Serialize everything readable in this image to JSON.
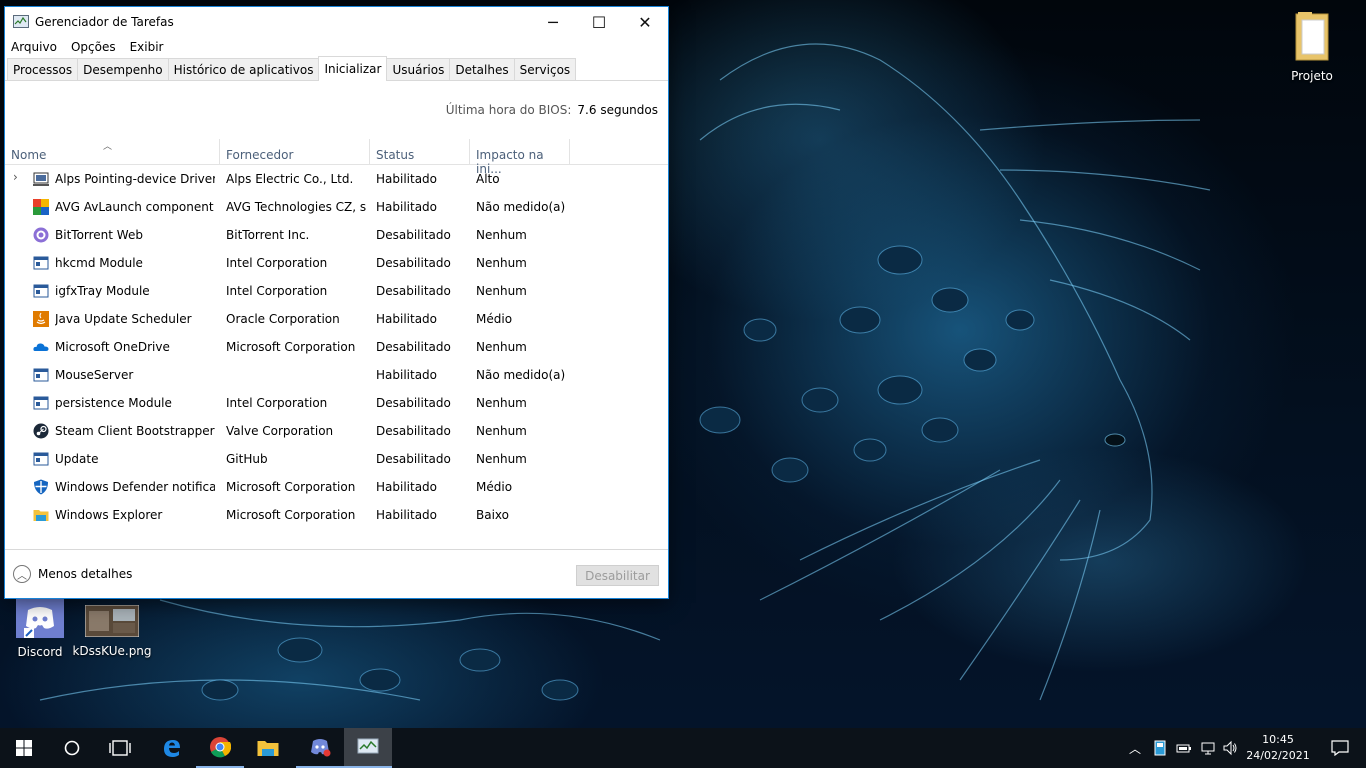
{
  "window": {
    "title": "Gerenciador de Tarefas",
    "controls": {
      "minimize": "─",
      "maximize": "☐",
      "close": "✕"
    }
  },
  "menu": [
    "Arquivo",
    "Opções",
    "Exibir"
  ],
  "tabs": [
    "Processos",
    "Desempenho",
    "Histórico de aplicativos",
    "Inicializar",
    "Usuários",
    "Detalhes",
    "Serviços"
  ],
  "active_tab": "Inicializar",
  "bios": {
    "label": "Última hora do BIOS:",
    "value": "7.6 segundos"
  },
  "columns": {
    "name": "Nome",
    "vendor": "Fornecedor",
    "status": "Status",
    "impact": "Impacto na ini..."
  },
  "rows": [
    {
      "name": "Alps Pointing-device Driver ...",
      "vendor": "Alps Electric Co., Ltd.",
      "status": "Habilitado",
      "impact": "Alto",
      "icon": "alps-icon"
    },
    {
      "name": "AVG AvLaunch component",
      "vendor": "AVG Technologies CZ, s....",
      "status": "Habilitado",
      "impact": "Não medido(a)",
      "icon": "avg-icon"
    },
    {
      "name": "BitTorrent Web",
      "vendor": "BitTorrent Inc.",
      "status": "Desabilitado",
      "impact": "Nenhum",
      "icon": "bittorrent-icon"
    },
    {
      "name": "hkcmd Module",
      "vendor": "Intel Corporation",
      "status": "Desabilitado",
      "impact": "Nenhum",
      "icon": "app-window-icon"
    },
    {
      "name": "igfxTray Module",
      "vendor": "Intel Corporation",
      "status": "Desabilitado",
      "impact": "Nenhum",
      "icon": "app-window-icon"
    },
    {
      "name": "Java Update Scheduler",
      "vendor": "Oracle Corporation",
      "status": "Habilitado",
      "impact": "Médio",
      "icon": "java-icon"
    },
    {
      "name": "Microsoft OneDrive",
      "vendor": "Microsoft Corporation",
      "status": "Desabilitado",
      "impact": "Nenhum",
      "icon": "onedrive-icon"
    },
    {
      "name": "MouseServer",
      "vendor": "",
      "status": "Habilitado",
      "impact": "Não medido(a)",
      "icon": "app-window-icon"
    },
    {
      "name": "persistence Module",
      "vendor": "Intel Corporation",
      "status": "Desabilitado",
      "impact": "Nenhum",
      "icon": "app-window-icon"
    },
    {
      "name": "Steam Client Bootstrapper",
      "vendor": "Valve Corporation",
      "status": "Desabilitado",
      "impact": "Nenhum",
      "icon": "steam-icon"
    },
    {
      "name": "Update",
      "vendor": "GitHub",
      "status": "Desabilitado",
      "impact": "Nenhum",
      "icon": "app-window-icon"
    },
    {
      "name": "Windows Defender notificati...",
      "vendor": "Microsoft Corporation",
      "status": "Habilitado",
      "impact": "Médio",
      "icon": "defender-icon"
    },
    {
      "name": "Windows Explorer",
      "vendor": "Microsoft Corporation",
      "status": "Habilitado",
      "impact": "Baixo",
      "icon": "explorer-folder-icon"
    }
  ],
  "footer": {
    "less_details": "Menos detalhes",
    "disable": "Desabilitar"
  },
  "desktop_icons": {
    "projeto": "Projeto",
    "discord": "Discord",
    "kdss": "kDssKUe.png"
  },
  "taskbar": {
    "apps": [
      "start-icon",
      "cortana-icon",
      "task-view-icon",
      "edge-icon",
      "chrome-icon",
      "file-explorer-icon",
      "discord-taskbar-icon",
      "task-manager-icon"
    ],
    "clock_time": "10:45",
    "clock_date": "24/02/2021"
  },
  "colors": {
    "accent": "#1883d7",
    "taskbar": "#0c1219"
  }
}
